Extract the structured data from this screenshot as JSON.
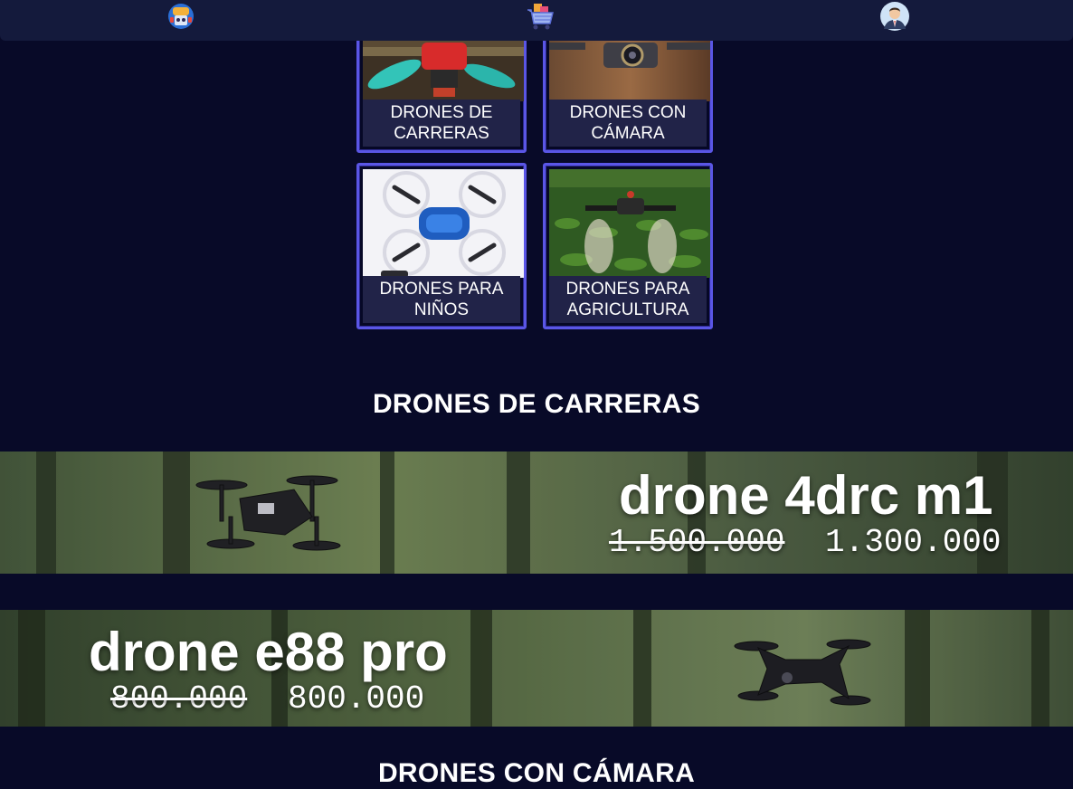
{
  "nav": {
    "home_icon": "robot-badge-icon",
    "cart_icon": "shopping-cart-icon",
    "account_icon": "user-avatar-icon"
  },
  "categories": [
    {
      "label": "DRONES DE CARRERAS",
      "icon": "racing-drone-photo"
    },
    {
      "label": "DRONES CON CÁMARA",
      "icon": "camera-drone-photo"
    },
    {
      "label": "DRONES PARA NIÑOS",
      "icon": "kids-drone-photo"
    },
    {
      "label": "DRONES PARA AGRICULTURA",
      "icon": "agriculture-drone-photo"
    }
  ],
  "sections": [
    {
      "title": "DRONES DE CARRERAS"
    },
    {
      "title": "DRONES CON CÁMARA"
    }
  ],
  "products": [
    {
      "name": "drone 4drc m1",
      "old_price": "1.500.000",
      "price": "1.300.000"
    },
    {
      "name": "drone e88 pro",
      "old_price": "800.000",
      "price": "800.000"
    }
  ],
  "colors": {
    "background": "#080a28",
    "card_border": "#5a56e6",
    "label_bg": "#212348",
    "nav_bg": "#141a3c"
  }
}
